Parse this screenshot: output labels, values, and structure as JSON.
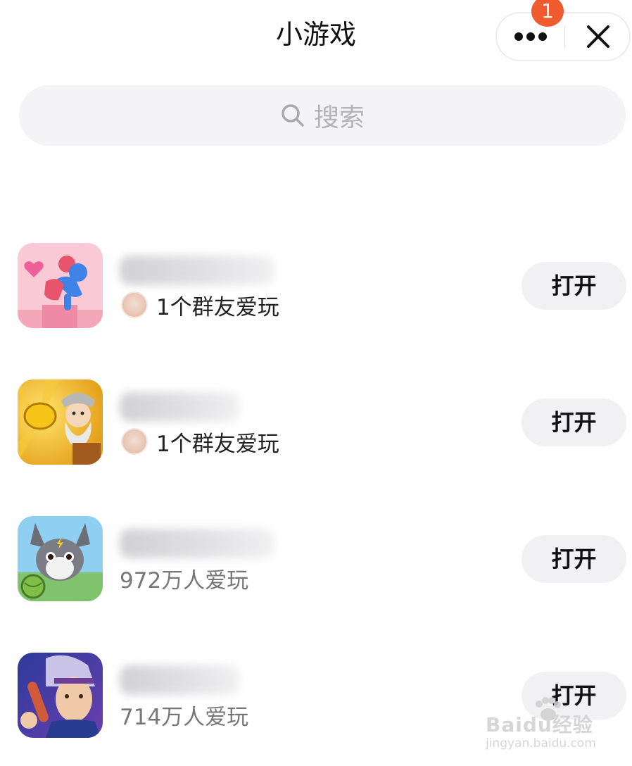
{
  "header": {
    "title": "小游戏",
    "notification_count": "1",
    "more_icon": "more-dots-icon",
    "close_icon": "close-icon"
  },
  "search": {
    "placeholder": "搜索",
    "icon": "search-icon"
  },
  "games": [
    {
      "icon": "game-icon-jump",
      "social_text": "1个群友爱玩",
      "button_label": "打开"
    },
    {
      "icon": "game-icon-gold-miner",
      "social_text": "1个群友爱玩",
      "button_label": "打开"
    },
    {
      "icon": "game-icon-cartoon",
      "players_text": "972万人爱玩",
      "button_label": "打开"
    },
    {
      "icon": "game-icon-hero",
      "players_text": "714万人爱玩",
      "button_label": "打开"
    }
  ],
  "watermark": {
    "main": "Baidu经验",
    "sub": "jingyan.baidu.com"
  },
  "colors": {
    "badge": "#ef5a2f",
    "button_bg": "#f1f1f4",
    "search_bg": "#f4f4f6"
  }
}
